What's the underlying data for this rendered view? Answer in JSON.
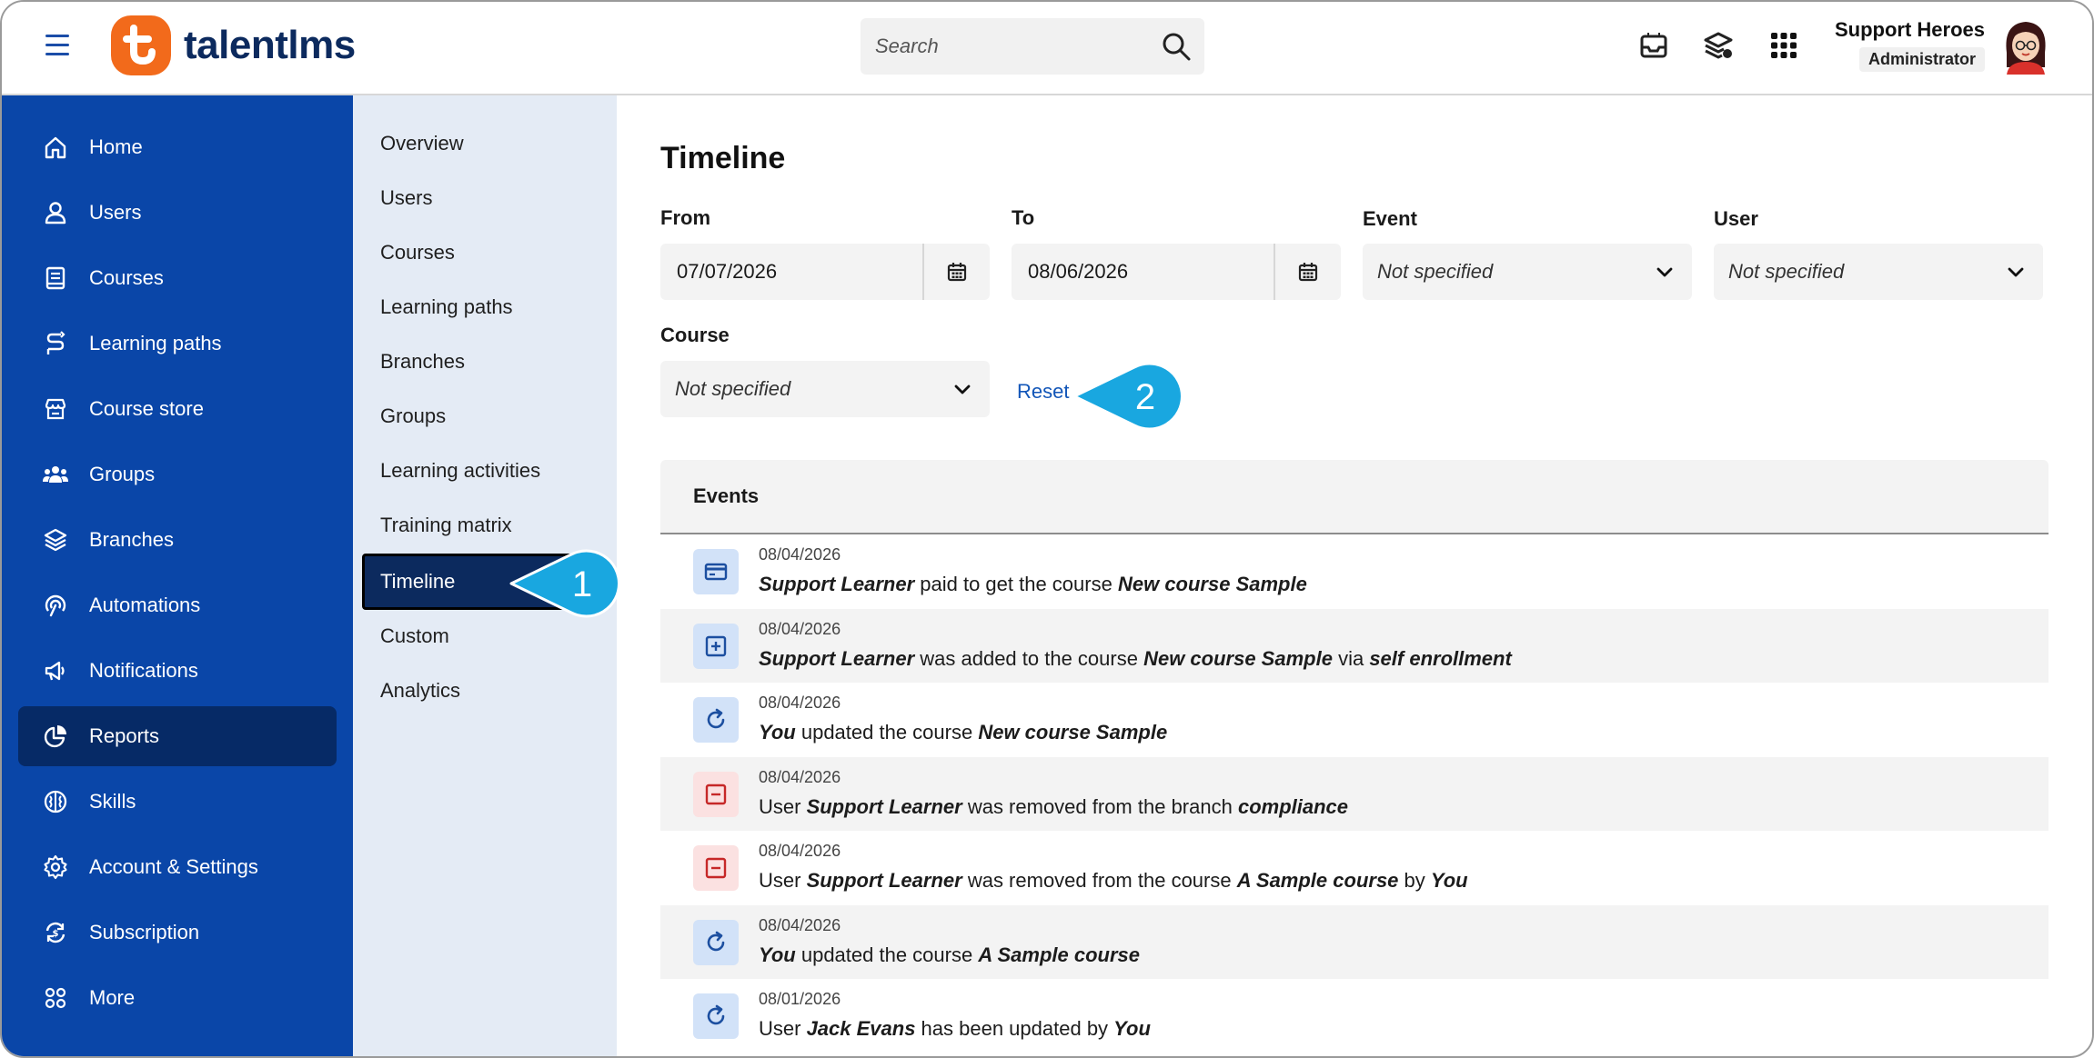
{
  "header": {
    "logo_text": "talentlms",
    "search_placeholder": "Search",
    "user_name": "Support Heroes",
    "user_role": "Administrator"
  },
  "sidebar": {
    "items": [
      {
        "label": "Home",
        "icon": "home-icon"
      },
      {
        "label": "Users",
        "icon": "user-icon"
      },
      {
        "label": "Courses",
        "icon": "book-icon"
      },
      {
        "label": "Learning paths",
        "icon": "path-icon"
      },
      {
        "label": "Course store",
        "icon": "store-icon"
      },
      {
        "label": "Groups",
        "icon": "groups-icon"
      },
      {
        "label": "Branches",
        "icon": "layers-icon"
      },
      {
        "label": "Automations",
        "icon": "automation-icon"
      },
      {
        "label": "Notifications",
        "icon": "megaphone-icon"
      },
      {
        "label": "Reports",
        "icon": "pie-chart-icon",
        "active": true
      },
      {
        "label": "Skills",
        "icon": "brain-icon"
      },
      {
        "label": "Account & Settings",
        "icon": "gear-icon"
      },
      {
        "label": "Subscription",
        "icon": "subscription-icon"
      },
      {
        "label": "More",
        "icon": "grid-dots-icon"
      }
    ]
  },
  "submenu": {
    "items": [
      {
        "label": "Overview"
      },
      {
        "label": "Users"
      },
      {
        "label": "Courses"
      },
      {
        "label": "Learning paths"
      },
      {
        "label": "Branches"
      },
      {
        "label": "Groups"
      },
      {
        "label": "Learning activities"
      },
      {
        "label": "Training matrix"
      },
      {
        "label": "Timeline",
        "active": true
      },
      {
        "label": "Custom"
      },
      {
        "label": "Analytics"
      }
    ]
  },
  "main": {
    "title": "Timeline",
    "from_label": "From",
    "from_value": "07/07/2026",
    "to_label": "To",
    "to_value": "08/06/2026",
    "event_label": "Event",
    "event_value": "Not specified",
    "user_label": "User",
    "user_value": "Not specified",
    "course_label": "Course",
    "course_value": "Not specified",
    "reset_label": "Reset"
  },
  "events": {
    "header": "Events",
    "rows": [
      {
        "date": "08/04/2026",
        "icon": "credit-card-icon",
        "color": "blue"
      },
      {
        "date": "08/04/2026",
        "icon": "plus-square-icon",
        "color": "blue"
      },
      {
        "date": "08/04/2026",
        "icon": "refresh-icon",
        "color": "blue"
      },
      {
        "date": "08/04/2026",
        "icon": "minus-square-icon",
        "color": "red"
      },
      {
        "date": "08/04/2026",
        "icon": "minus-square-icon",
        "color": "red"
      },
      {
        "date": "08/04/2026",
        "icon": "refresh-icon",
        "color": "blue"
      },
      {
        "date": "08/01/2026",
        "icon": "refresh-icon",
        "color": "blue"
      }
    ],
    "texts": {
      "r0": {
        "a": "Support Learner",
        "b": " paid to get the course ",
        "c": "New course Sample"
      },
      "r1": {
        "a": "Support Learner",
        "b": " was added to the course ",
        "c": "New course Sample",
        "d": " via ",
        "e": "self enrollment"
      },
      "r2": {
        "a": "You",
        "b": " updated the course ",
        "c": "New course Sample"
      },
      "r3": {
        "a": "User ",
        "b": "Support Learner",
        "c": " was removed from the branch ",
        "d": "compliance"
      },
      "r4": {
        "a": "User ",
        "b": "Support Learner",
        "c": " was removed from the course ",
        "d": "A Sample course",
        "e": " by ",
        "f": "You"
      },
      "r5": {
        "a": "You",
        "b": " updated the course ",
        "c": "A Sample course"
      },
      "r6": {
        "a": "User ",
        "b": "Jack Evans",
        "c": " has been updated by ",
        "d": "You"
      }
    }
  },
  "callouts": {
    "one": "1",
    "two": "2"
  },
  "colors": {
    "sidebar": "#0a46a8",
    "sidebar_active": "#062a66",
    "submenu": "#e4ebf5",
    "accent_orange": "#f26a1b",
    "callout": "#19a7e0",
    "link": "#1256b8"
  }
}
